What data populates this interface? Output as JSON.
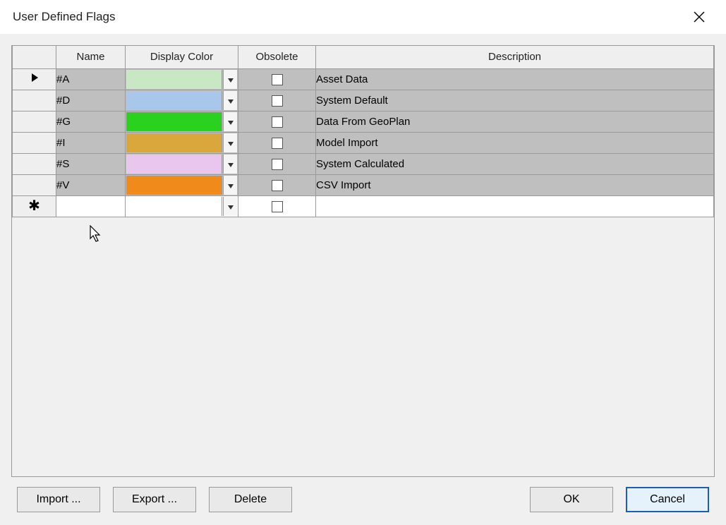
{
  "window": {
    "title": "User Defined Flags"
  },
  "grid": {
    "headers": {
      "name": "Name",
      "display_color": "Display Color",
      "obsolete": "Obsolete",
      "description": "Description"
    },
    "rows": [
      {
        "selected": true,
        "name": "#A",
        "color": "#c8e8c4",
        "obsolete": false,
        "description": "Asset Data"
      },
      {
        "selected": false,
        "name": "#D",
        "color": "#a9c7ea",
        "obsolete": false,
        "description": "System Default"
      },
      {
        "selected": false,
        "name": "#G",
        "color": "#2bd11f",
        "obsolete": false,
        "description": "Data From GeoPlan"
      },
      {
        "selected": false,
        "name": "#I",
        "color": "#d9a73c",
        "obsolete": false,
        "description": "Model Import"
      },
      {
        "selected": false,
        "name": "#S",
        "color": "#e9c6ee",
        "obsolete": false,
        "description": "System Calculated"
      },
      {
        "selected": false,
        "name": "#V",
        "color": "#f08a1a",
        "obsolete": false,
        "description": "CSV Import"
      }
    ]
  },
  "buttons": {
    "import": "Import ...",
    "export": "Export ...",
    "delete": "Delete",
    "ok": "OK",
    "cancel": "Cancel"
  }
}
